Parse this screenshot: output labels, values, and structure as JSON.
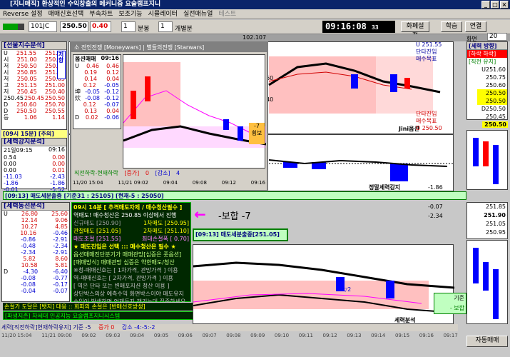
{
  "window": {
    "title": "[지니매직] 환상적인 수익창출의 메커니즘 요술램프지니",
    "min": "_",
    "max": "□",
    "close": "×"
  },
  "menu": [
    "Reverse 설정",
    "매매신호선택",
    "부속차트",
    "보조기능",
    "시뮬레이터",
    "실전매뉴얼",
    "테스트"
  ],
  "toolbar": {
    "code": "101JC",
    "price": "250.50",
    "change": "0.40",
    "qty1": "1",
    "unit1": "분봉",
    "qty2": "1",
    "unit2": "개별분",
    "clock": "09:16:08",
    "clock_sec": "33",
    "btn1": "화폐설정",
    "btn2": "학습",
    "btn3": "연결",
    "screen_label": "화면",
    "screen_no": "20"
  },
  "ticker": {
    "text": "102.107"
  },
  "left_panel": {
    "title": "[선물지수분석]",
    "rows": [
      [
        "U",
        "251.55",
        "251.60"
      ],
      [
        "시",
        "251.00",
        "250.90"
      ],
      [
        "저",
        "250.50",
        "250.70"
      ],
      [
        "시",
        "250.85",
        "251.00"
      ],
      [
        "저",
        "250.05",
        "250.05"
      ],
      [
        "고",
        "251.15",
        "251.00"
      ],
      [
        "저",
        "250.45",
        "250.40"
      ],
      [
        "250.45",
        "250.45",
        "250.50"
      ],
      [
        "D",
        "250.60",
        "250.70"
      ],
      [
        "D",
        "250.50",
        "250.55"
      ],
      [
        "등",
        "1.06",
        "1.14"
      ]
    ],
    "side": "저항",
    "footer": "[09시 15분] [주의]",
    "sub_title": "[세력강지분석]",
    "sub_time": "21일09:15",
    "sub_time2": "09:16",
    "sub_rows": [
      [
        "0.54",
        "0.00"
      ],
      [
        "0.00",
        "0.00"
      ],
      [
        "0.00",
        "0.01"
      ],
      [
        "-11.03",
        "-2.43"
      ],
      [
        "-1.86",
        "-1.86"
      ],
      [
        "-0.01",
        "-5.52"
      ]
    ],
    "bottom_title": "[세력동선분석]",
    "bottom_rows": [
      [
        "U",
        "26.80",
        "25.60"
      ],
      [
        "",
        "12.14",
        "9.06"
      ],
      [
        "",
        "10.27",
        "4.85"
      ],
      [
        "",
        "10.16",
        "-0.46"
      ],
      [
        "",
        "-0.86",
        "-2.91"
      ],
      [
        "",
        "-0.48",
        "-2.34"
      ],
      [
        "",
        "-2.34",
        "-2.91"
      ],
      [
        "",
        "5.82",
        "8.60"
      ],
      [
        "",
        "10.58",
        "5.81"
      ],
      [
        "D",
        "-4.30",
        "-6.40"
      ],
      [
        "",
        "-0.08",
        "-0.77"
      ],
      [
        "",
        "-0.08",
        "-0.17"
      ],
      [
        "",
        "-0.04",
        "-0.07"
      ]
    ]
  },
  "popup": {
    "title": "소 전인전쟁 [Moneywars] | 별들의전쟁 [Starwars]",
    "header": "옵션매매",
    "time": "09:16",
    "rows": [
      [
        "U",
        "0.46",
        "0.46"
      ],
      [
        "",
        "0.19",
        "0.12"
      ],
      [
        "",
        "0.14",
        "0.04"
      ],
      [
        "",
        "0.12",
        "-0.05"
      ],
      [
        "坤",
        "-0.05",
        "-0.12"
      ],
      [
        "炊",
        "-0.08",
        "-0.12"
      ],
      [
        "",
        "0.12",
        "-0.07"
      ],
      [
        "",
        "0.13",
        "0.04"
      ],
      [
        "D",
        "0.02",
        "-0.06"
      ]
    ],
    "ylabels": [
      "-7",
      "횡보",
      "10",
      "0",
      "-10"
    ],
    "footer": "직전하락-현재하락",
    "inc_label": "[증가]",
    "inc": "0",
    "dec_label": "[감소]",
    "dec": "4",
    "xaxis": [
      "11/20 15:04",
      "11/21 09:02",
      "09:04",
      "09:06",
      "09:08",
      "09:10",
      "09:12",
      "09:14",
      "09:16"
    ]
  },
  "right_panel": {
    "top": [
      "U 251.55",
      "단타진입",
      "매수목표"
    ],
    "top2": [
      "단타진입",
      "매수목표"
    ],
    "d_label": "D 250.50",
    "box_title": "[세력 방향]",
    "box_sub": "[하락 하락]",
    "box_sub2": "[직전 유지]",
    "vals": [
      "U251.60",
      "250.75",
      "250.60",
      "250.50",
      "250.50",
      "D250.50",
      "250.45"
    ],
    "mid": "250.50",
    "mid2": "-1.86",
    "bottom": [
      "-0.07",
      "-2.34"
    ],
    "bottom_box": [
      "251.85",
      "251.90",
      "251.05",
      "250.95"
    ],
    "bottom_label": "기준",
    "bottom_label2": "- 보합",
    "auto_btn": "자동매매"
  },
  "main_chart": {
    "yticks": [
      "60",
      "40",
      "20",
      "0"
    ],
    "right_label": "Jini옵션",
    "xaxis": [
      "09:06",
      "09:08",
      "09:10",
      "09:12",
      "09:14",
      "09:16"
    ]
  },
  "mid_chart": {
    "label": "정말세력감지",
    "xaxis": [
      "09:13"
    ]
  },
  "status_bar": {
    "text": "[09:13] 매도세분출중 [기준31 : 25105] [현재-5 : 25050]"
  },
  "info_box": {
    "line1": "09시 14분 [ 추격매도자제 / 매수청산필수 ]",
    "line2": "역매도! 매수청산은 250.85 이상에서 진행",
    "l3a": "신규매도 [250.90]",
    "l3b": "1차매도 [250.95]",
    "l4a": "관찰매도 [251.05]",
    "l4b": "2차매도 [251.10]",
    "l5a": "매도조절 [251.55]",
    "l5b": "최대손절폭 [ 0.70]",
    "line6": "★ 매도진입은 선택 ::: 매수청산은 필수 ★",
    "line7": "옵션매매진단분기가 매매관망[심증은 풋옵션]",
    "line8": "[매매방식] 매매관망 심증은 약한매도/청산",
    "n1": "※청-매매신호는 [ 1차가격, 관망가격 ] 이용",
    "n2": " 역-매매신호는 [ 2차가격, 관망가격 ] 이용",
    "n3": "[ 역은 단타 또는 변매포지션 청산 이용 ]",
    "n4": " 상단박스의상 예측수익 화면박스이야 매도유지",
    "n5": " 수익이 발생하면 언제든지 챙기는데 집중하세요",
    "line9": "손절가 도달은 [뱃지] 대응 :: 회피의 손절은 [반매선호방생]",
    "line10": "[파생지존] 차세대 인공지능 요술램프지니시스템",
    "arrow_label": "-보합 -7",
    "sell_box": "[09:13] 매도세분출중[251.05]"
  },
  "bottom_chart": {
    "label": "세력분석",
    "label2": "옵션매매",
    "note": "▽2"
  },
  "bottom_axis": {
    "left": "세력[직전하락]현재하락유지] 기준 -5",
    "inc": "증가 0",
    "dec": "감소 -4:-5:-2",
    "xaxis": [
      "11/20 15:04",
      "11/21 09:00",
      "09:02",
      "09:03",
      "09:04",
      "09:05",
      "09:06",
      "09:07",
      "09:08",
      "09:09",
      "09:10",
      "09:11",
      "09:12",
      "09:13",
      "09:14",
      "09:15",
      "09:16",
      "09:17"
    ]
  },
  "colors": {
    "titlebar": "#0a246a",
    "panel_bg": "#d4d0c8",
    "bull": "#ff0000",
    "bear": "#0000ff",
    "info_bg": "#002800"
  }
}
